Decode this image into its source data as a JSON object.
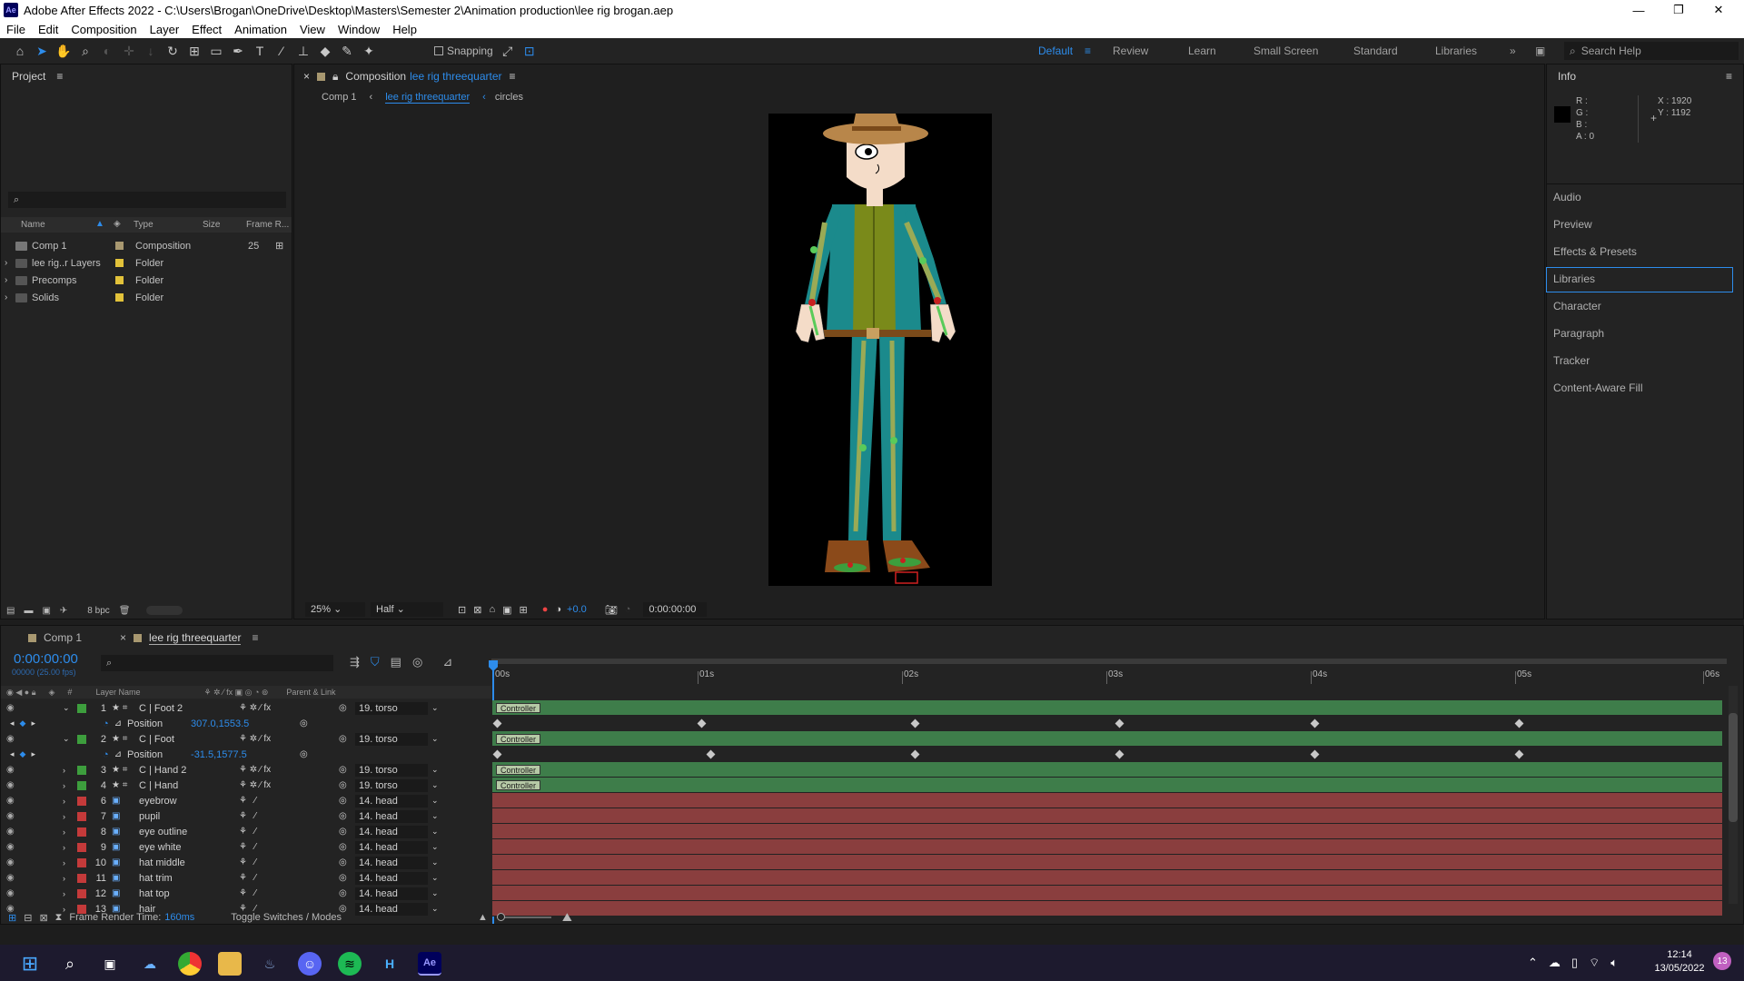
{
  "app": {
    "logo": "Ae",
    "title": "Adobe After Effects 2022 - C:\\Users\\Brogan\\OneDrive\\Desktop\\Masters\\Semester 2\\Animation production\\lee rig brogan.aep",
    "minimize": "—",
    "maximize": "❐",
    "close": "✕"
  },
  "menu": [
    "File",
    "Edit",
    "Composition",
    "Layer",
    "Effect",
    "Animation",
    "View",
    "Window",
    "Help"
  ],
  "toolbar": {
    "snapping": "Snapping",
    "workspaces": [
      "Default",
      "Review",
      "Learn",
      "Small Screen",
      "Standard",
      "Libraries"
    ],
    "active_workspace": "Default",
    "search_help": "Search Help"
  },
  "project": {
    "title": "Project",
    "columns": [
      "Name",
      "Type",
      "Size",
      "Frame R..."
    ],
    "items": [
      {
        "name": "Comp 1",
        "type": "Composition",
        "size": "",
        "frame_rate": "25",
        "color": "#a89870"
      },
      {
        "name": "lee rig..r Layers",
        "type": "Folder",
        "size": "",
        "frame_rate": "",
        "color": "#e2c23a"
      },
      {
        "name": "Precomps",
        "type": "Folder",
        "size": "",
        "frame_rate": "",
        "color": "#e2c23a"
      },
      {
        "name": "Solids",
        "type": "Folder",
        "size": "",
        "frame_rate": "",
        "color": "#e2c23a"
      }
    ],
    "bpc": "8 bpc"
  },
  "composition": {
    "panel_prefix": "Composition",
    "name": "lee rig threequarter",
    "breadcrumbs": [
      "Comp 1",
      "lee rig threequarter",
      "circles"
    ],
    "zoom": "25%",
    "resolution": "Half",
    "exposure": "+0.0",
    "timecode": "0:00:00:00"
  },
  "info": {
    "title": "Info",
    "r": "R :",
    "g": "G :",
    "b": "B :",
    "a": "A : 0",
    "x": "X : 1920",
    "y": "Y : 1192"
  },
  "right_panels": [
    "Audio",
    "Preview",
    "Effects & Presets",
    "Libraries",
    "Character",
    "Paragraph",
    "Tracker",
    "Content-Aware Fill"
  ],
  "right_panel_active": "Libraries",
  "timeline": {
    "tabs": [
      "Comp 1",
      "lee rig threequarter"
    ],
    "timecode": "0:00:00:00",
    "frame_info": "00000 (25.00 fps)",
    "ruler": [
      "00s",
      "01s",
      "02s",
      "03s",
      "04s",
      "05s",
      "06s"
    ],
    "column_headers": {
      "layer_name": "Layer Name",
      "parent": "Parent & Link"
    },
    "layers": [
      {
        "num": "1",
        "name": "C | Foot 2",
        "parent": "19. torso",
        "color": "#3d9e3d",
        "kind": "shape",
        "bar": "green",
        "tag": "Controller",
        "prop": "Position",
        "prop_value": "307.0,1553.5"
      },
      {
        "num": "2",
        "name": "C | Foot",
        "parent": "19. torso",
        "color": "#3d9e3d",
        "kind": "shape",
        "bar": "green",
        "tag": "Controller",
        "prop": "Position",
        "prop_value": "-31.5,1577.5"
      },
      {
        "num": "3",
        "name": "C | Hand 2",
        "parent": "19. torso",
        "color": "#3d9e3d",
        "kind": "shape",
        "bar": "green",
        "tag": "Controller"
      },
      {
        "num": "4",
        "name": "C | Hand",
        "parent": "19. torso",
        "color": "#3d9e3d",
        "kind": "shape",
        "bar": "green",
        "tag": "Controller"
      },
      {
        "num": "6",
        "name": "eyebrow",
        "parent": "14. head",
        "color": "#c43a3a",
        "kind": "comp",
        "bar": "red"
      },
      {
        "num": "7",
        "name": "pupil",
        "parent": "14. head",
        "color": "#c43a3a",
        "kind": "comp",
        "bar": "red"
      },
      {
        "num": "8",
        "name": "eye outline",
        "parent": "14. head",
        "color": "#c43a3a",
        "kind": "comp",
        "bar": "red"
      },
      {
        "num": "9",
        "name": "eye white",
        "parent": "14. head",
        "color": "#c43a3a",
        "kind": "comp",
        "bar": "red"
      },
      {
        "num": "10",
        "name": "hat middle",
        "parent": "14. head",
        "color": "#c43a3a",
        "kind": "comp",
        "bar": "red"
      },
      {
        "num": "11",
        "name": "hat trim",
        "parent": "14. head",
        "color": "#c43a3a",
        "kind": "comp",
        "bar": "red"
      },
      {
        "num": "12",
        "name": "hat top",
        "parent": "14. head",
        "color": "#c43a3a",
        "kind": "comp",
        "bar": "red"
      },
      {
        "num": "13",
        "name": "hair",
        "parent": "14. head",
        "color": "#c43a3a",
        "kind": "comp",
        "bar": "red"
      }
    ],
    "render_time_label": "Frame Render Time:",
    "render_time": "160ms",
    "toggle": "Toggle Switches / Modes"
  },
  "taskbar": {
    "time": "12:14",
    "date": "13/05/2022",
    "notifications": "13"
  }
}
